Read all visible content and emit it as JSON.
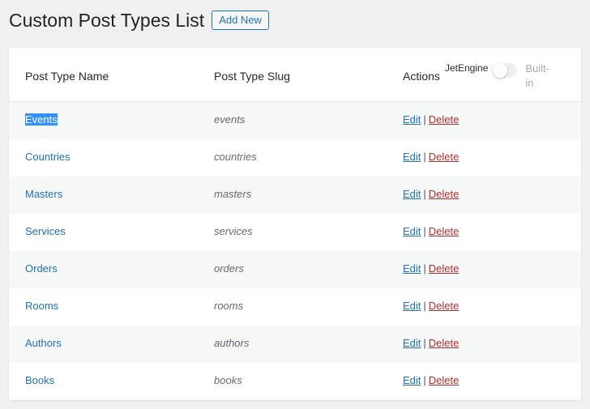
{
  "header": {
    "title": "Custom Post Types List",
    "add_new_label": "Add New"
  },
  "table": {
    "columns": {
      "name": "Post Type Name",
      "slug": "Post Type Slug",
      "actions": "Actions"
    },
    "toggle": {
      "left_label": "JetEngine",
      "right_label": "Built-in",
      "state": "JetEngine"
    },
    "edit_label": "Edit",
    "separator": "|",
    "delete_label": "Delete",
    "rows": [
      {
        "name": "Events",
        "slug": "events",
        "selected": true
      },
      {
        "name": "Countries",
        "slug": "countries"
      },
      {
        "name": "Masters",
        "slug": "masters"
      },
      {
        "name": "Services",
        "slug": "services"
      },
      {
        "name": "Orders",
        "slug": "orders"
      },
      {
        "name": "Rooms",
        "slug": "rooms"
      },
      {
        "name": "Authors",
        "slug": "authors"
      },
      {
        "name": "Books",
        "slug": "books"
      }
    ]
  },
  "colors": {
    "link": "#2271b1",
    "delete": "#b32d2e",
    "selection": "#3390ff"
  }
}
